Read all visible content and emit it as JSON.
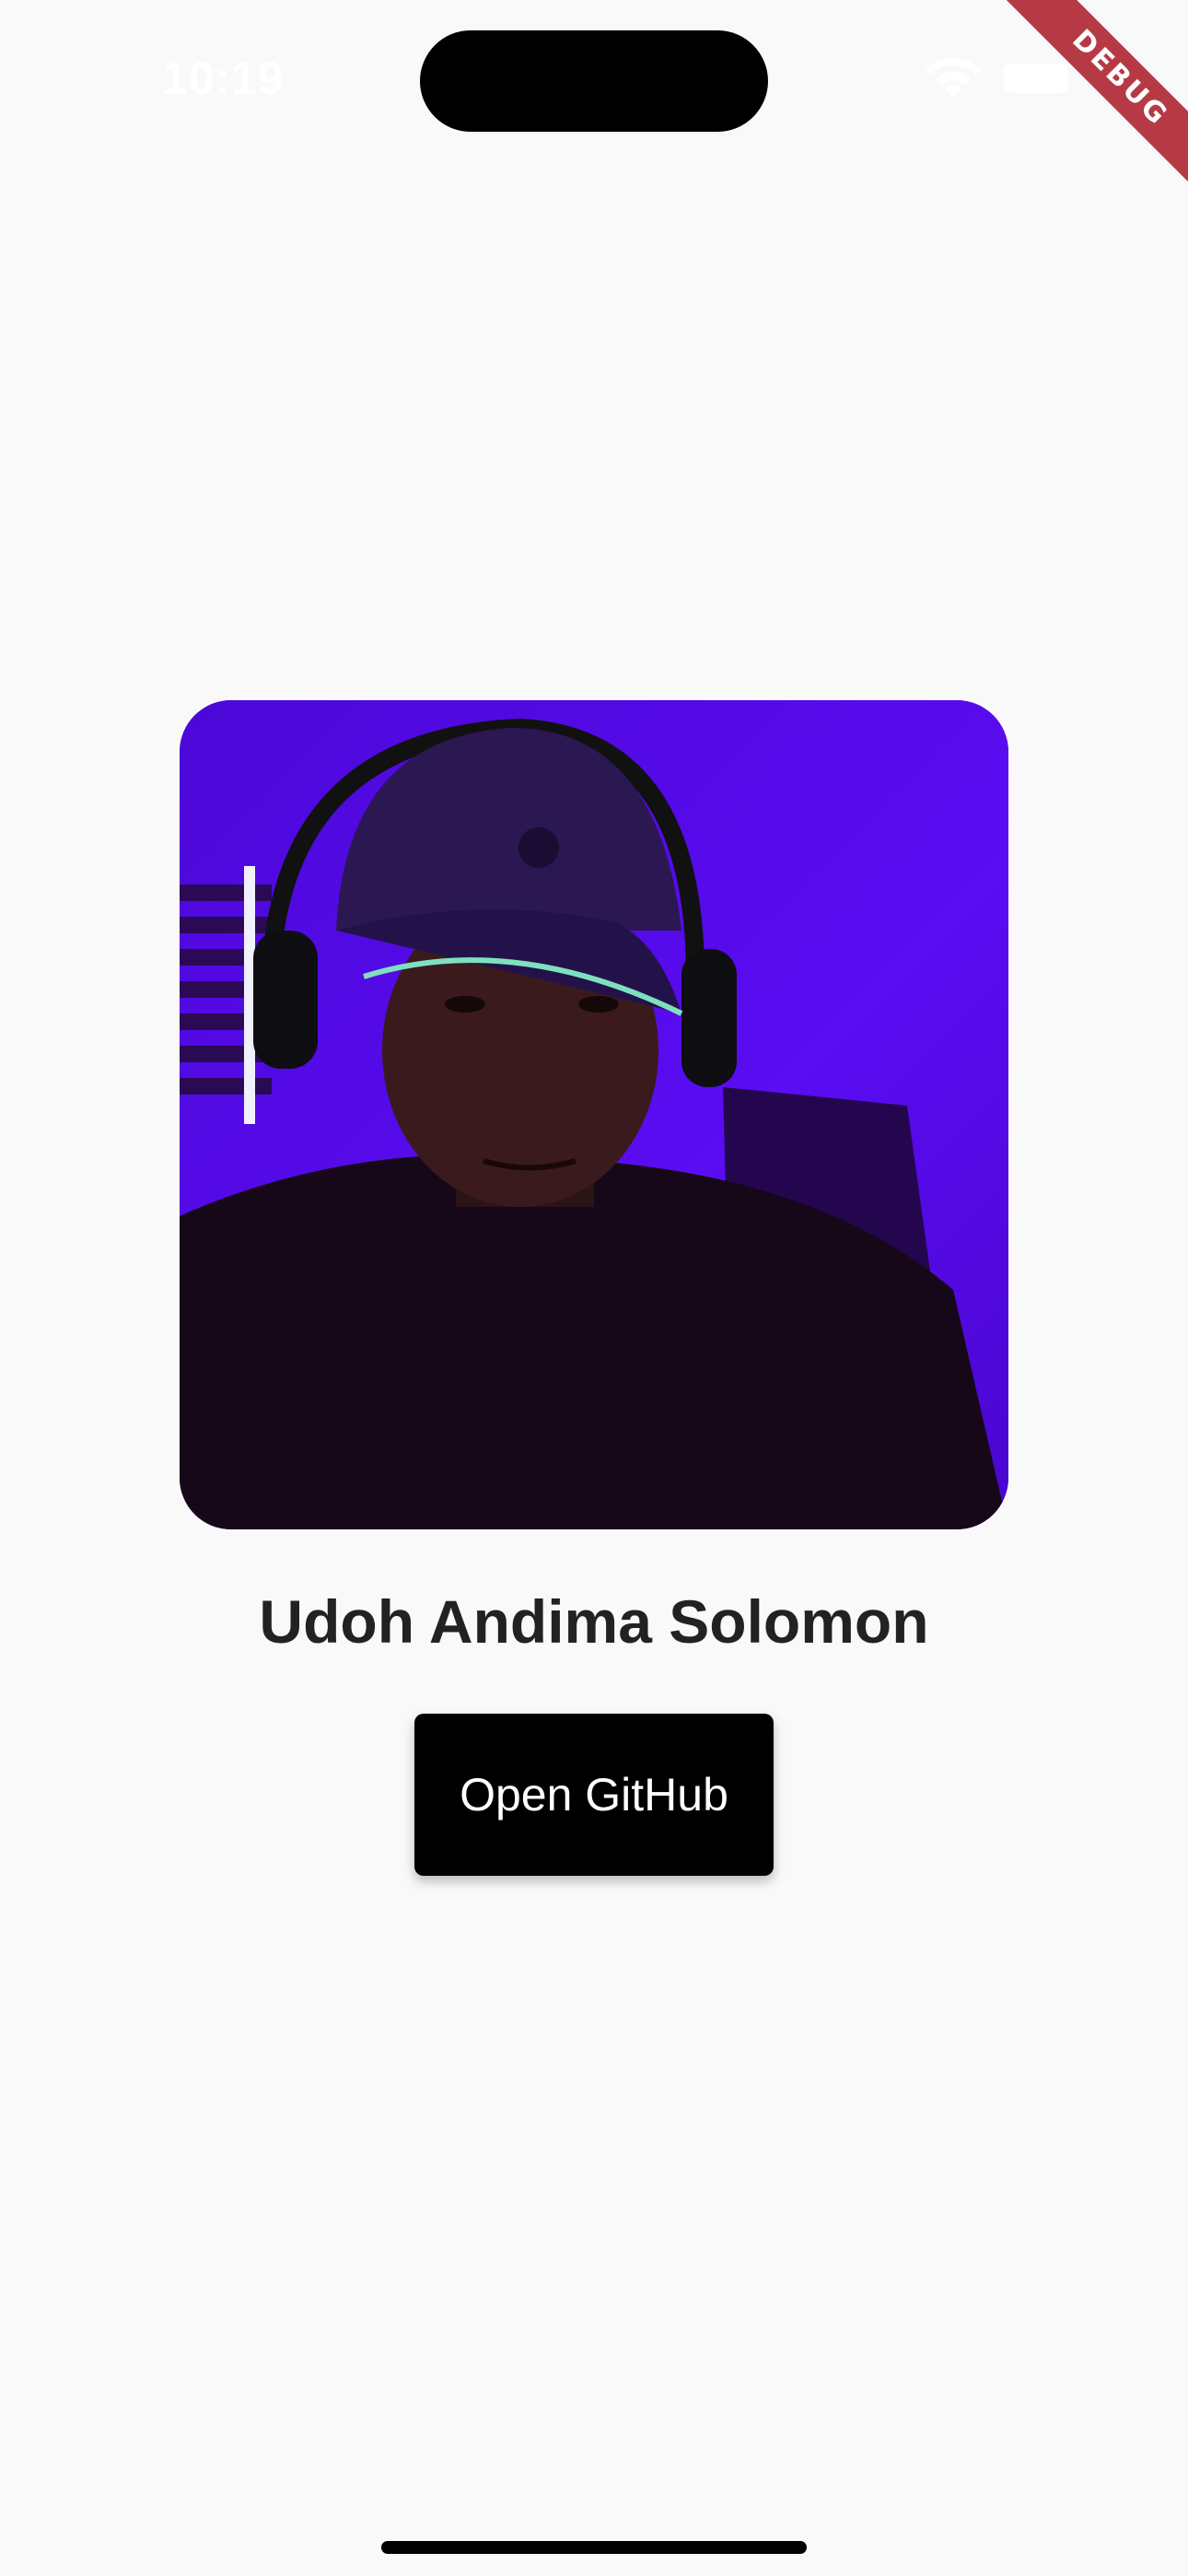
{
  "status_bar": {
    "time": "10:19"
  },
  "debug_banner": {
    "label": "DEBUG"
  },
  "profile": {
    "photo_icon": "profile-photo",
    "name": "Udoh Andima Solomon",
    "button_label": "Open GitHub"
  },
  "colors": {
    "background": "#f9f9f9",
    "button": "#000000",
    "button_text": "#ffffff",
    "name_text": "#222222",
    "debug_ribbon": "#b63a45"
  }
}
